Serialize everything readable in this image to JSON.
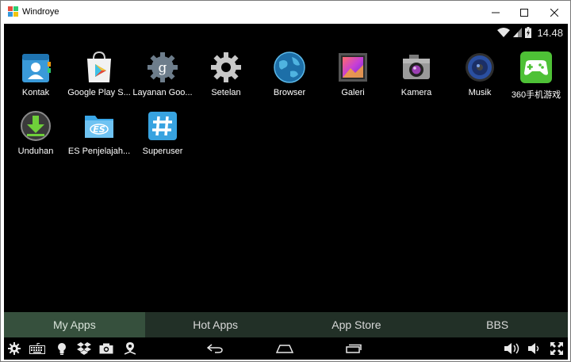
{
  "window": {
    "title": "Windroye"
  },
  "statusbar": {
    "time": "14.48"
  },
  "apps": [
    {
      "label": "Kontak",
      "icon": "contacts-icon"
    },
    {
      "label": "Google Play S...",
      "icon": "play-store-icon"
    },
    {
      "label": "Layanan Goo...",
      "icon": "google-services-icon"
    },
    {
      "label": "Setelan",
      "icon": "settings-icon"
    },
    {
      "label": "Browser",
      "icon": "globe-icon"
    },
    {
      "label": "Galeri",
      "icon": "gallery-icon"
    },
    {
      "label": "Kamera",
      "icon": "camera-icon"
    },
    {
      "label": "Musik",
      "icon": "music-icon"
    },
    {
      "label": "360手机游戏",
      "icon": "gamepad-icon"
    },
    {
      "label": "Unduhan",
      "icon": "download-icon"
    },
    {
      "label": "ES Penjelajah...",
      "icon": "es-file-icon"
    },
    {
      "label": "Superuser",
      "icon": "superuser-icon"
    }
  ],
  "tabs": [
    {
      "label": "My Apps",
      "active": true
    },
    {
      "label": "Hot Apps",
      "active": false
    },
    {
      "label": "App Store",
      "active": false
    },
    {
      "label": "BBS",
      "active": false
    }
  ],
  "colors": {
    "screen_bg": "#000000",
    "tabbar_bg": "#223027",
    "tab_active_bg": "#36503d"
  }
}
